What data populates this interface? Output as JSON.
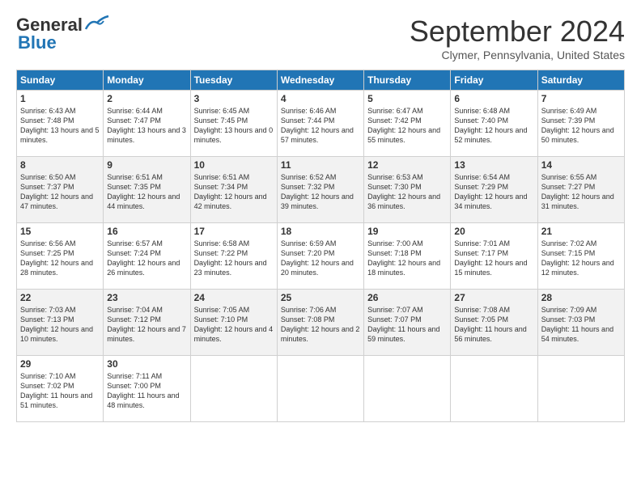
{
  "logo": {
    "line1": "General",
    "line2": "Blue"
  },
  "title": "September 2024",
  "location": "Clymer, Pennsylvania, United States",
  "days_of_week": [
    "Sunday",
    "Monday",
    "Tuesday",
    "Wednesday",
    "Thursday",
    "Friday",
    "Saturday"
  ],
  "weeks": [
    [
      {
        "day": "1",
        "rise": "6:43 AM",
        "set": "7:48 PM",
        "daylight": "13 hours and 5 minutes."
      },
      {
        "day": "2",
        "rise": "6:44 AM",
        "set": "7:47 PM",
        "daylight": "13 hours and 3 minutes."
      },
      {
        "day": "3",
        "rise": "6:45 AM",
        "set": "7:45 PM",
        "daylight": "13 hours and 0 minutes."
      },
      {
        "day": "4",
        "rise": "6:46 AM",
        "set": "7:44 PM",
        "daylight": "12 hours and 57 minutes."
      },
      {
        "day": "5",
        "rise": "6:47 AM",
        "set": "7:42 PM",
        "daylight": "12 hours and 55 minutes."
      },
      {
        "day": "6",
        "rise": "6:48 AM",
        "set": "7:40 PM",
        "daylight": "12 hours and 52 minutes."
      },
      {
        "day": "7",
        "rise": "6:49 AM",
        "set": "7:39 PM",
        "daylight": "12 hours and 50 minutes."
      }
    ],
    [
      {
        "day": "8",
        "rise": "6:50 AM",
        "set": "7:37 PM",
        "daylight": "12 hours and 47 minutes."
      },
      {
        "day": "9",
        "rise": "6:51 AM",
        "set": "7:35 PM",
        "daylight": "12 hours and 44 minutes."
      },
      {
        "day": "10",
        "rise": "6:51 AM",
        "set": "7:34 PM",
        "daylight": "12 hours and 42 minutes."
      },
      {
        "day": "11",
        "rise": "6:52 AM",
        "set": "7:32 PM",
        "daylight": "12 hours and 39 minutes."
      },
      {
        "day": "12",
        "rise": "6:53 AM",
        "set": "7:30 PM",
        "daylight": "12 hours and 36 minutes."
      },
      {
        "day": "13",
        "rise": "6:54 AM",
        "set": "7:29 PM",
        "daylight": "12 hours and 34 minutes."
      },
      {
        "day": "14",
        "rise": "6:55 AM",
        "set": "7:27 PM",
        "daylight": "12 hours and 31 minutes."
      }
    ],
    [
      {
        "day": "15",
        "rise": "6:56 AM",
        "set": "7:25 PM",
        "daylight": "12 hours and 28 minutes."
      },
      {
        "day": "16",
        "rise": "6:57 AM",
        "set": "7:24 PM",
        "daylight": "12 hours and 26 minutes."
      },
      {
        "day": "17",
        "rise": "6:58 AM",
        "set": "7:22 PM",
        "daylight": "12 hours and 23 minutes."
      },
      {
        "day": "18",
        "rise": "6:59 AM",
        "set": "7:20 PM",
        "daylight": "12 hours and 20 minutes."
      },
      {
        "day": "19",
        "rise": "7:00 AM",
        "set": "7:18 PM",
        "daylight": "12 hours and 18 minutes."
      },
      {
        "day": "20",
        "rise": "7:01 AM",
        "set": "7:17 PM",
        "daylight": "12 hours and 15 minutes."
      },
      {
        "day": "21",
        "rise": "7:02 AM",
        "set": "7:15 PM",
        "daylight": "12 hours and 12 minutes."
      }
    ],
    [
      {
        "day": "22",
        "rise": "7:03 AM",
        "set": "7:13 PM",
        "daylight": "12 hours and 10 minutes."
      },
      {
        "day": "23",
        "rise": "7:04 AM",
        "set": "7:12 PM",
        "daylight": "12 hours and 7 minutes."
      },
      {
        "day": "24",
        "rise": "7:05 AM",
        "set": "7:10 PM",
        "daylight": "12 hours and 4 minutes."
      },
      {
        "day": "25",
        "rise": "7:06 AM",
        "set": "7:08 PM",
        "daylight": "12 hours and 2 minutes."
      },
      {
        "day": "26",
        "rise": "7:07 AM",
        "set": "7:07 PM",
        "daylight": "11 hours and 59 minutes."
      },
      {
        "day": "27",
        "rise": "7:08 AM",
        "set": "7:05 PM",
        "daylight": "11 hours and 56 minutes."
      },
      {
        "day": "28",
        "rise": "7:09 AM",
        "set": "7:03 PM",
        "daylight": "11 hours and 54 minutes."
      }
    ],
    [
      {
        "day": "29",
        "rise": "7:10 AM",
        "set": "7:02 PM",
        "daylight": "11 hours and 51 minutes."
      },
      {
        "day": "30",
        "rise": "7:11 AM",
        "set": "7:00 PM",
        "daylight": "11 hours and 48 minutes."
      },
      null,
      null,
      null,
      null,
      null
    ]
  ]
}
